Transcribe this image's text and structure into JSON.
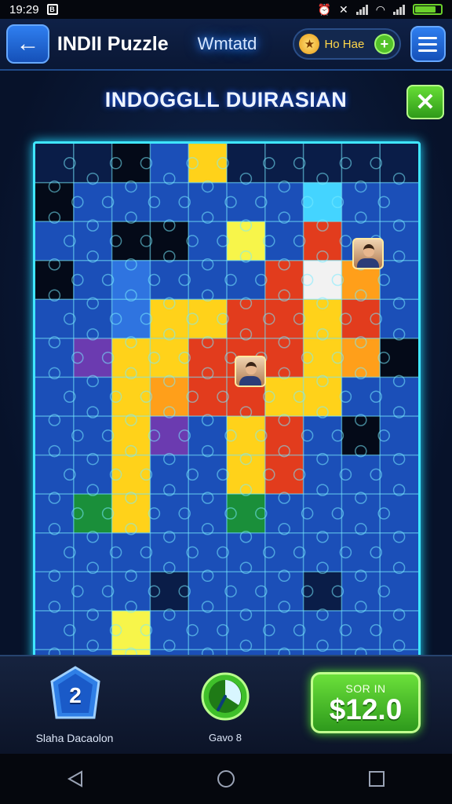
{
  "status_bar": {
    "time": "19:29"
  },
  "header": {
    "back_icon": "arrow-left-icon",
    "title": "INDII Puzzle",
    "mode": "Wmtatd",
    "coins_label": "Ho Hae",
    "coin_icon": "coin-icon",
    "plus_icon": "plus-icon",
    "menu_icon": "hamburger-menu-icon"
  },
  "puzzle": {
    "title": "INDOGGLL DUIRASIAN",
    "close_icon": "close-x-icon",
    "grid_columns": 10,
    "grid_rows": 14,
    "colors": {
      "B": "#1b4fb8",
      "D": "#0a1d48",
      "K": "#040a18",
      "Y": "#ffd21a",
      "O": "#ff9f1a",
      "R": "#e23c1d",
      "G": "#1a8f3a",
      "C": "#44d4ff",
      "W": "#f2f2f2",
      "P": "#6b3bb0",
      "L": "#2f74e0",
      "F": "#f7f54a"
    },
    "rows": [
      "DDKBYDDDDD",
      "KBBBBBBCBB",
      "BBKKBYBRBB",
      "KBLBBBROOB",
      "BBLYYRRYRB",
      "BPYYRRRYOK",
      "BBYORRYYBB",
      "BBYPBYRBKB",
      "BBYBBYRBBB",
      "BGYBBGBBBB",
      "BBBBBBBBBB",
      "BBBDBBBDBB",
      "BBBBBBBBBB",
      "BBFBBBBBBB"
    ],
    "highlights": [
      {
        "row": 3,
        "col": 7,
        "color": "W"
      },
      {
        "row": 2,
        "col": 5,
        "color": "F"
      },
      {
        "row": 12,
        "col": 2,
        "color": "F"
      }
    ],
    "avatar_icons": [
      "person-avatar-icon",
      "person-avatar-icon"
    ]
  },
  "footer": {
    "level_icon": "level-shield-icon",
    "level_number": "2",
    "level_label": "Slaha Dacaolon",
    "timer_icon": "timer-clock-icon",
    "timer_label": "Gavo 8",
    "reward_label": "SOR IN",
    "reward_amount": "$12.0"
  },
  "nav": {
    "back_icon": "nav-back-triangle-icon",
    "home_icon": "nav-home-circle-icon",
    "recents_icon": "nav-recents-square-icon"
  }
}
